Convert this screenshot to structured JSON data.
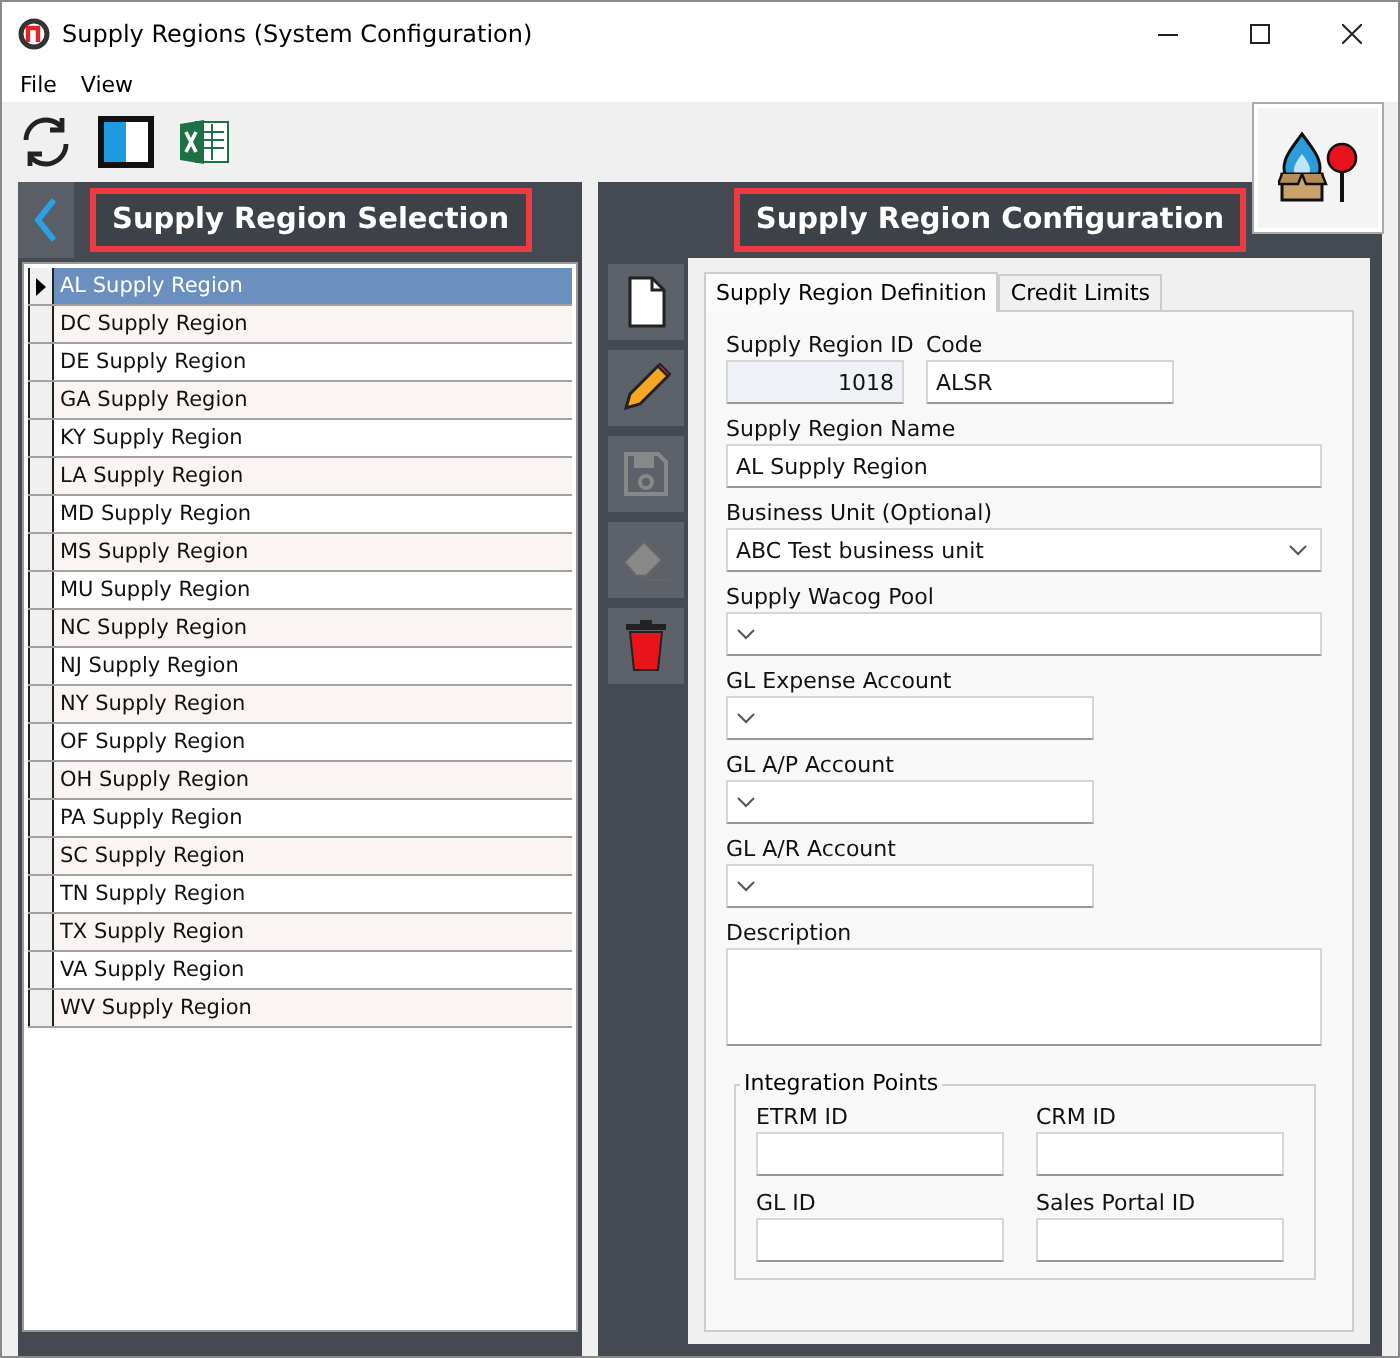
{
  "window": {
    "title": "Supply Regions (System Configuration)"
  },
  "menu": [
    {
      "label": "File"
    },
    {
      "label": "View"
    }
  ],
  "toolbar": [
    {
      "kind": "refresh"
    },
    {
      "kind": "layout"
    },
    {
      "kind": "excel"
    }
  ],
  "left_panel": {
    "title": "Supply Region Selection",
    "rows": [
      {
        "name": "AL Supply Region",
        "selected": true
      },
      {
        "name": "DC Supply Region",
        "selected": false
      },
      {
        "name": "DE Supply Region",
        "selected": false
      },
      {
        "name": "GA Supply Region",
        "selected": false
      },
      {
        "name": "KY Supply Region",
        "selected": false
      },
      {
        "name": "LA Supply Region",
        "selected": false
      },
      {
        "name": "MD Supply Region",
        "selected": false
      },
      {
        "name": "MS Supply Region",
        "selected": false
      },
      {
        "name": "MU Supply Region",
        "selected": false
      },
      {
        "name": "NC Supply Region",
        "selected": false
      },
      {
        "name": "NJ Supply Region",
        "selected": false
      },
      {
        "name": "NY Supply Region",
        "selected": false
      },
      {
        "name": "OF Supply Region",
        "selected": false
      },
      {
        "name": "OH Supply Region",
        "selected": false
      },
      {
        "name": "PA Supply Region",
        "selected": false
      },
      {
        "name": "SC Supply Region",
        "selected": false
      },
      {
        "name": "TN Supply Region",
        "selected": false
      },
      {
        "name": "TX Supply Region",
        "selected": false
      },
      {
        "name": "VA Supply Region",
        "selected": false
      },
      {
        "name": "WV Supply Region",
        "selected": false
      }
    ]
  },
  "right_panel": {
    "title": "Supply Region Configuration",
    "tools": [
      {
        "kind": "new",
        "disabled": false
      },
      {
        "kind": "edit",
        "disabled": false
      },
      {
        "kind": "save",
        "disabled": true
      },
      {
        "kind": "erase",
        "disabled": true
      },
      {
        "kind": "delete",
        "disabled": false
      }
    ],
    "tabs": [
      {
        "label": "Supply Region Definition",
        "selected": true
      },
      {
        "label": "Credit Limits",
        "selected": false
      }
    ],
    "field_rows": [
      [
        {
          "kind": "id",
          "label": "Supply Region ID",
          "value": "1018"
        },
        {
          "kind": "code",
          "label": "Code",
          "value": "ALSR"
        }
      ],
      [
        {
          "kind": "text",
          "label": "Supply Region Name",
          "value": "AL Supply Region"
        }
      ],
      [
        {
          "kind": "dropdown",
          "label": "Business Unit (Optional)",
          "value": "ABC Test business unit"
        }
      ],
      [
        {
          "kind": "dropdown",
          "label": "Supply Wacog Pool"
        }
      ],
      [
        {
          "kind": "account",
          "label": "GL Expense Account"
        }
      ],
      [
        {
          "kind": "account",
          "label": "GL A/P Account"
        }
      ],
      [
        {
          "kind": "account",
          "label": "GL A/R Account"
        }
      ],
      [
        {
          "kind": "memo",
          "label": "Description"
        }
      ]
    ],
    "integration": {
      "title": "Integration Points",
      "fields": [
        {
          "label": "ETRM ID"
        },
        {
          "label": "CRM ID"
        },
        {
          "label": "GL ID"
        },
        {
          "label": "Sales Portal ID"
        }
      ]
    }
  }
}
